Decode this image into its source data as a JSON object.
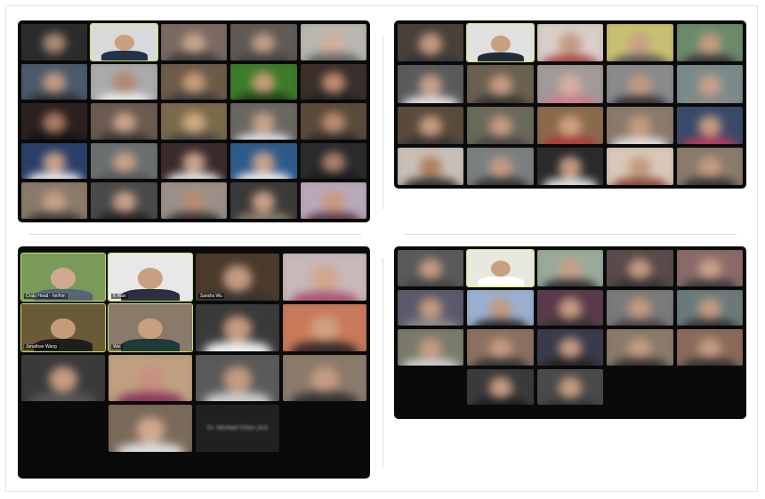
{
  "screens": [
    {
      "id": "p1",
      "tiles": [
        {
          "bg": "#2b2b2b",
          "face": "#a98a74",
          "cloth": "#2a2a2a"
        },
        {
          "sharp": true,
          "name": "",
          "bg": "#d9d9d9",
          "face": "#caa07e",
          "cloth": "#23314a"
        },
        {
          "bg": "#7a6a62",
          "face": "#c6a38a",
          "cloth": "#3a3a3a"
        },
        {
          "bg": "#5f5a55",
          "face": "#c09c88",
          "cloth": "#444"
        },
        {
          "bg": "#b9b6b0",
          "face": "#d2b09a",
          "cloth": "#666"
        },
        {
          "bg": "#4a5a6a",
          "face": "#c09a80",
          "cloth": "#2a2f35"
        },
        {
          "bg": "#aaa",
          "face": "#b08870",
          "cloth": "#eee"
        },
        {
          "bg": "#6e5a48",
          "face": "#c49c78",
          "cloth": "#3a3a3a"
        },
        {
          "bg": "#3d7a2a",
          "face": "#c49c78",
          "cloth": "#1c3a12"
        },
        {
          "bg": "#3a2e2a",
          "face": "#c08870",
          "cloth": "#222"
        },
        {
          "bg": "#2a2020",
          "face": "#a87860",
          "cloth": "#111"
        },
        {
          "bg": "#6a5a50",
          "face": "#c8a088",
          "cloth": "#333"
        },
        {
          "bg": "#7a6a4a",
          "face": "#d0a880",
          "cloth": "#444"
        },
        {
          "bg": "#6a6660",
          "face": "#c4a088",
          "cloth": "#ddd"
        },
        {
          "bg": "#5a4a3a",
          "face": "#b88c6c",
          "cloth": "#2a2a2a"
        },
        {
          "bg": "#2a3e6a",
          "face": "#c8a088",
          "cloth": "#e8e8e8"
        },
        {
          "bg": "#6a7070",
          "face": "#c8a088",
          "cloth": "#555"
        },
        {
          "bg": "#3a2a2a",
          "face": "#c8a088",
          "cloth": "#e0e0e0"
        },
        {
          "bg": "#2e5a8a",
          "face": "#c8a088",
          "cloth": "#eee"
        },
        {
          "bg": "#2a2a2a",
          "face": "#a8806a",
          "cloth": "#1a1a1a"
        },
        {
          "bg": "#8a7a6a",
          "face": "#c8a088",
          "cloth": "#3a3a3a"
        },
        {
          "bg": "#4a4a4a",
          "face": "#c8a088",
          "cloth": "#222"
        },
        {
          "bg": "#9a9088",
          "face": "#b88c70",
          "cloth": "#333"
        },
        {
          "bg": "#3a3a3a",
          "face": "#c8a088",
          "cloth": "#8a7a6a"
        },
        {
          "bg": "#b8a8b8",
          "face": "#c89a80",
          "cloth": "#5a3a4a"
        }
      ]
    },
    {
      "id": "p2",
      "tiles": [
        {
          "bg": "#4a4038",
          "face": "#c09a80",
          "cloth": "#333"
        },
        {
          "sharp": true,
          "name": "",
          "bg": "#e0e0e0",
          "face": "#c8a080",
          "cloth": "#232a3a"
        },
        {
          "bg": "#d8cfc8",
          "face": "#c49a80",
          "cloth": "#aa4444"
        },
        {
          "bg": "#c8c070",
          "face": "#c8a088",
          "cloth": "#555"
        },
        {
          "bg": "#6a8a6a",
          "face": "#c49a80",
          "cloth": "#333"
        },
        {
          "bg": "#5a5a5a",
          "face": "#c8a088",
          "cloth": "#ddd"
        },
        {
          "bg": "#6a6050",
          "face": "#c49a80",
          "cloth": "#333"
        },
        {
          "bg": "#a09a98",
          "face": "#d8b0a0",
          "cloth": "#cc7a8a"
        },
        {
          "bg": "#8a8a8a",
          "face": "#c49a80",
          "cloth": "#333"
        },
        {
          "bg": "#7a8a8a",
          "face": "#c8a088",
          "cloth": "#888"
        },
        {
          "bg": "#5a4a3a",
          "face": "#c49a80",
          "cloth": "#333"
        },
        {
          "bg": "#6a6a5a",
          "face": "#c49a80",
          "cloth": "#444"
        },
        {
          "bg": "#8a6a4a",
          "face": "#d0a080",
          "cloth": "#aa3a3a"
        },
        {
          "bg": "#8a7a6a",
          "face": "#c49a80",
          "cloth": "#ddd"
        },
        {
          "bg": "#3a4a6a",
          "face": "#c49a80",
          "cloth": "#aa3a5a"
        },
        {
          "bg": "#c8c0b8",
          "face": "#b08060",
          "cloth": "#333"
        },
        {
          "bg": "#7a8080",
          "face": "#c49a80",
          "cloth": "#333"
        },
        {
          "bg": "#2a2a2a",
          "face": "#c49a80",
          "cloth": "#ddd"
        },
        {
          "bg": "#d8c8b8",
          "face": "#c49a80",
          "cloth": "#8a4a3a"
        },
        {
          "bg": "#8a7a6a",
          "face": "#c49a80",
          "cloth": "#333"
        }
      ]
    },
    {
      "id": "p3",
      "tiles": [
        {
          "sharp": true,
          "name": "Craig Head - he/him",
          "bg": "#7a9a5a",
          "face": "#d0a890",
          "cloth": "#556677"
        },
        {
          "sharp": true,
          "name": "K Wan",
          "bg": "#e8e8e8",
          "face": "#c8a080",
          "cloth": "#2a3040"
        },
        {
          "bg": "#4a3a2a",
          "face": "#c49a80",
          "cloth": "#333",
          "name": "Sandra Wu"
        },
        {
          "bg": "#c8b8b8",
          "face": "#d0a890",
          "cloth": "#aa5577"
        },
        {
          "sharp": true,
          "name": "Jonathan Wang",
          "bg": "#6a5a38",
          "face": "#c49a78",
          "cloth": "#1e1e1e"
        },
        {
          "sharp": true,
          "name": "Wei",
          "bg": "#8a7a6a",
          "face": "#c8a080",
          "cloth": "#1e3a3a"
        },
        {
          "bg": "#3a3a3a",
          "face": "#c49a80",
          "cloth": "#eee"
        },
        {
          "bg": "#c87a5a",
          "face": "#d0a080",
          "cloth": "#3a2a2a"
        },
        {
          "bg": "#3a3a3a",
          "face": "#c49a80",
          "cloth": "#555"
        },
        {
          "bg": "#c0a080",
          "face": "#c89080",
          "cloth": "#8a3a5a"
        },
        {
          "bg": "#5a5a5a",
          "face": "#c49a80",
          "cloth": "#ccc"
        },
        {
          "bg": "#8a7a6a",
          "face": "#c49a80",
          "cloth": "#333"
        },
        {
          "empty": true
        },
        {
          "bg": "#7a6a5a",
          "face": "#d0a890",
          "cloth": "#ddd"
        },
        {
          "label": "Dr. Michael Chen (AJ)"
        },
        {
          "empty": true
        }
      ]
    },
    {
      "id": "p4",
      "tiles": [
        {
          "bg": "#5a5a5a",
          "face": "#c49a80",
          "cloth": "#444"
        },
        {
          "sharp": true,
          "name": "",
          "bg": "#e8e8e0",
          "face": "#c8a080",
          "cloth": "#ffffff"
        },
        {
          "bg": "#9aaa9a",
          "face": "#c8a088",
          "cloth": "#333"
        },
        {
          "bg": "#5a4a4a",
          "face": "#c49a80",
          "cloth": "#333"
        },
        {
          "bg": "#8a6a6a",
          "face": "#c8a088",
          "cloth": "#3a3a3a"
        },
        {
          "bg": "#5a5a6a",
          "face": "#c49a80",
          "cloth": "#888"
        },
        {
          "bg": "#9ab0d0",
          "face": "#c49a80",
          "cloth": "#2a2a2a"
        },
        {
          "bg": "#5a3a4a",
          "face": "#c49a80",
          "cloth": "#333"
        },
        {
          "bg": "#7a7a7a",
          "face": "#c49a80",
          "cloth": "#444"
        },
        {
          "bg": "#6a7a7a",
          "face": "#c49a80",
          "cloth": "#333"
        },
        {
          "bg": "#7a7a6a",
          "face": "#c49a80",
          "cloth": "#ccc"
        },
        {
          "bg": "#8a7060",
          "face": "#c49a80",
          "cloth": "#333"
        },
        {
          "bg": "#3a3a4a",
          "face": "#c49a80",
          "cloth": "#222"
        },
        {
          "bg": "#8a7a6a",
          "face": "#c49a80",
          "cloth": "#333"
        },
        {
          "bg": "#8a6a5a",
          "face": "#c49a80",
          "cloth": "#333"
        },
        {
          "empty": true
        },
        {
          "bg": "#3a3a3a",
          "face": "#c49a80",
          "cloth": "#1a1a1a"
        },
        {
          "bg": "#4a4a4a",
          "face": "#c49a80",
          "cloth": "#333"
        },
        {
          "empty": true
        },
        {
          "empty": true
        }
      ]
    }
  ]
}
